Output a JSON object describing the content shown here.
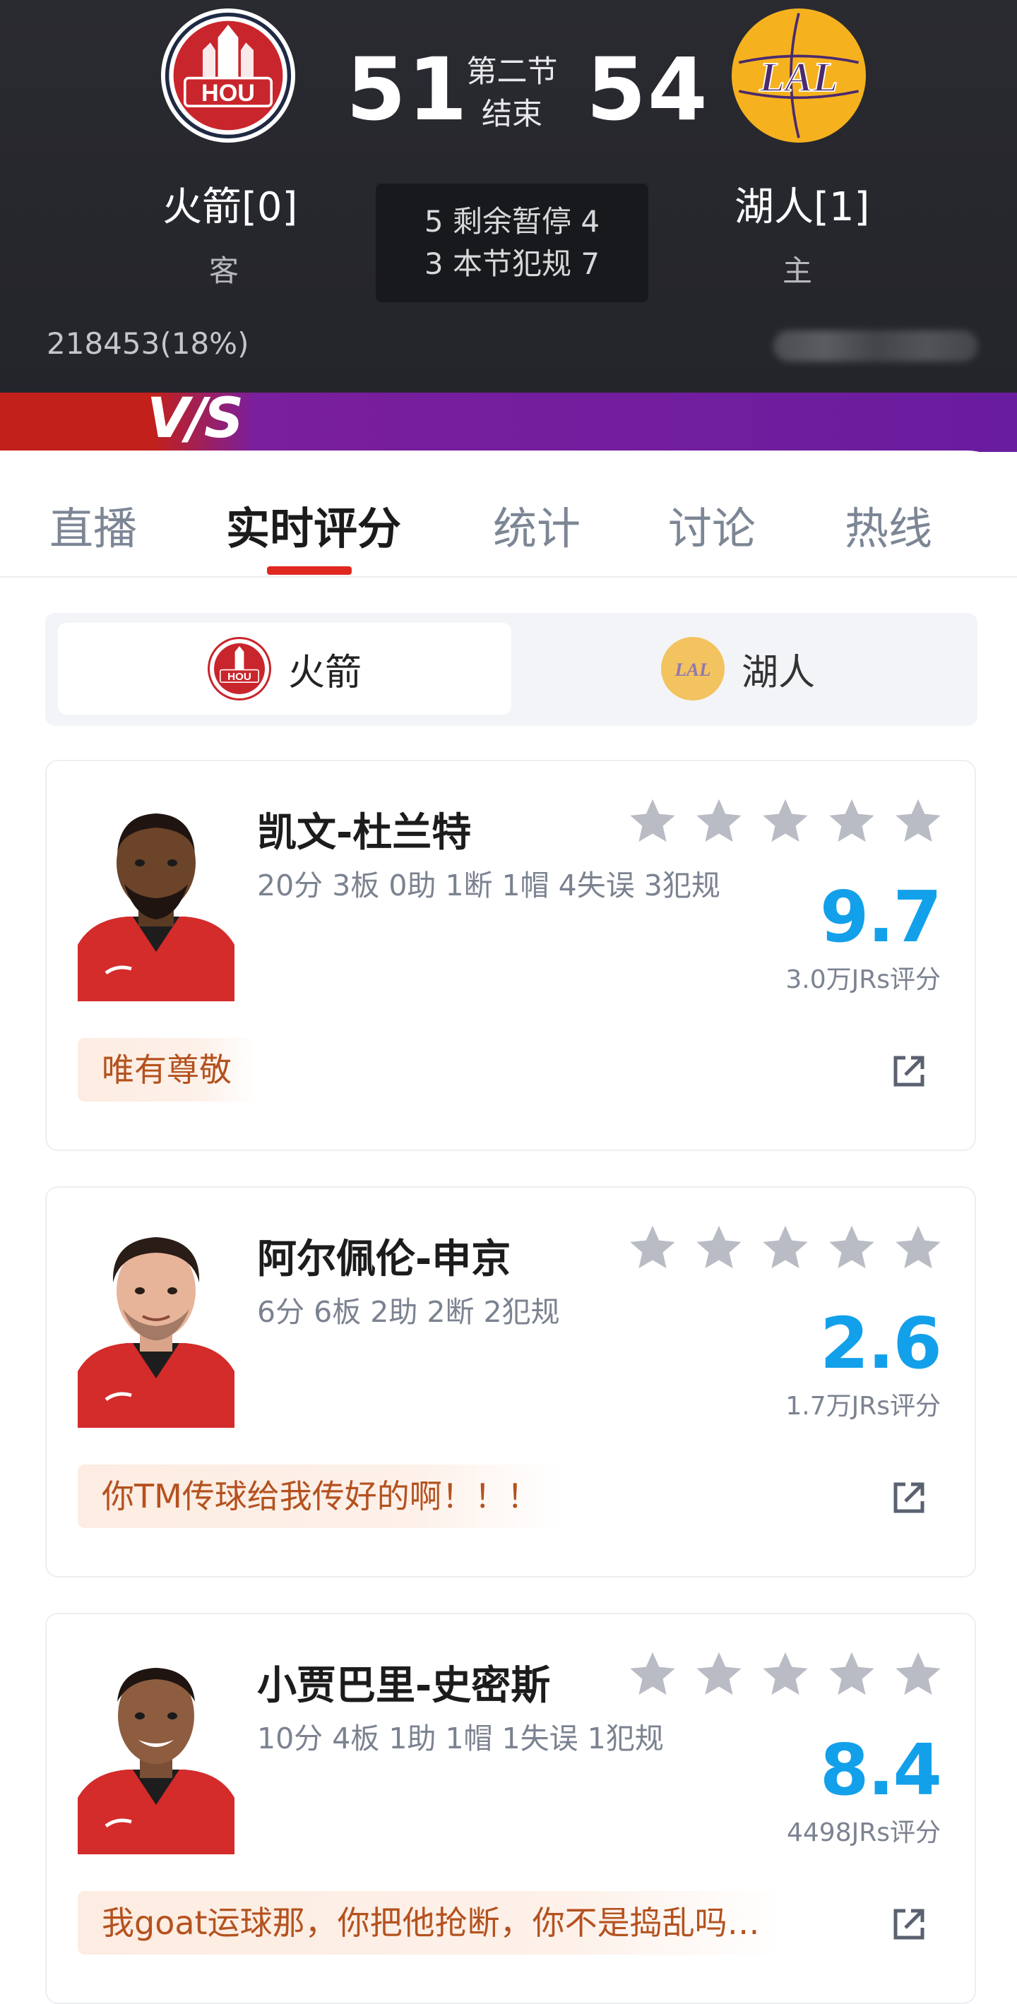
{
  "game": {
    "away": {
      "abbr": "HOU",
      "name": "火箭[0]",
      "side": "客",
      "score": "51",
      "color": "#c9252c"
    },
    "home": {
      "abbr": "LAL",
      "name": "湖人[1]",
      "side": "主",
      "score": "54",
      "color": "#5a2d82"
    },
    "period_line1": "第二节",
    "period_line2": "结束",
    "timeouts_line": "5 剩余暂停 4",
    "fouls_line": "3 本节犯规 7",
    "viewers": "218453(18%)",
    "vs": "VS"
  },
  "tabs": {
    "live": "直播",
    "rating": "实时评分",
    "stats": "统计",
    "discuss": "讨论",
    "hotline": "热线",
    "active": "实时评分"
  },
  "team_switch": {
    "away": "火箭",
    "home": "湖人",
    "active": "火箭"
  },
  "players": [
    {
      "name": "凯文-杜兰特",
      "stats": "20分 3板 0助 1断 1帽 4失误 3犯规",
      "rating": "9.7",
      "votes": "3.0万JRs评分",
      "comment": "唯有尊敬",
      "stars": 5
    },
    {
      "name": "阿尔佩伦-申京",
      "stats": "6分 6板 2助 2断 2犯规",
      "rating": "2.6",
      "votes": "1.7万JRs评分",
      "comment": "你TM传球给我传好的啊！！！",
      "stars": 5
    },
    {
      "name": "小贾巴里-史密斯",
      "stats": "10分 4板 1助 1帽 1失误 1犯规",
      "rating": "8.4",
      "votes": "4498JRs评分",
      "comment": "我goat运球那，你把他抢断，你不是捣乱吗…",
      "stars": 5
    }
  ],
  "colors": {
    "accent_red": "#e0281f",
    "rating_blue": "#13a0ea",
    "comment_orange": "#b4521f",
    "star_gray": "#b9bcc4"
  }
}
